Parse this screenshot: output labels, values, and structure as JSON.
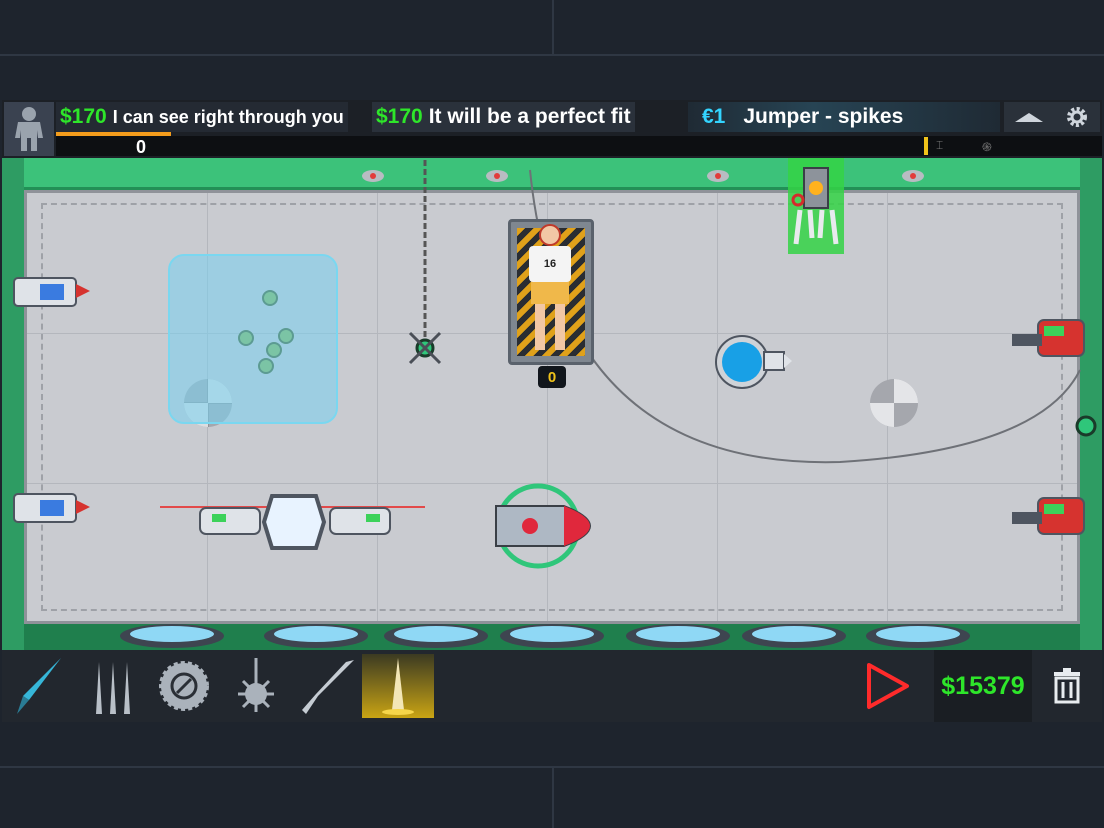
{
  "hud": {
    "quests": [
      {
        "price": "$170",
        "text": "I can see right through you"
      },
      {
        "price": "$170",
        "text": "It will be a perfect fit"
      },
      {
        "price": "€1",
        "text": "Jumper - spikes"
      }
    ],
    "score": "0",
    "progress": 0.11,
    "icons": {
      "avatar": "person-silhouette-icon",
      "collapse": "chevron-up-icon",
      "settings": "gear-icon"
    }
  },
  "arena": {
    "dummy_number": "16",
    "dummy_counter": "0"
  },
  "toolbar": {
    "tools": [
      {
        "name": "knife-tool",
        "icon": "knife-icon"
      },
      {
        "name": "spikes-tool",
        "icon": "spikes-icon"
      },
      {
        "name": "sawblade-tool",
        "icon": "sawblade-icon"
      },
      {
        "name": "mace-tool",
        "icon": "spiked-ball-icon"
      },
      {
        "name": "blade-tool",
        "icon": "blade-icon"
      },
      {
        "name": "floor-spike-tool",
        "icon": "floor-spike-icon",
        "selected": true
      }
    ],
    "money": "$15379",
    "play_icon": "play-icon",
    "trash_icon": "trash-icon"
  },
  "colors": {
    "money": "#2ee62a",
    "euro": "#33d4ff",
    "progress": "#f39c1c",
    "arena_wall": "#31a56a"
  }
}
